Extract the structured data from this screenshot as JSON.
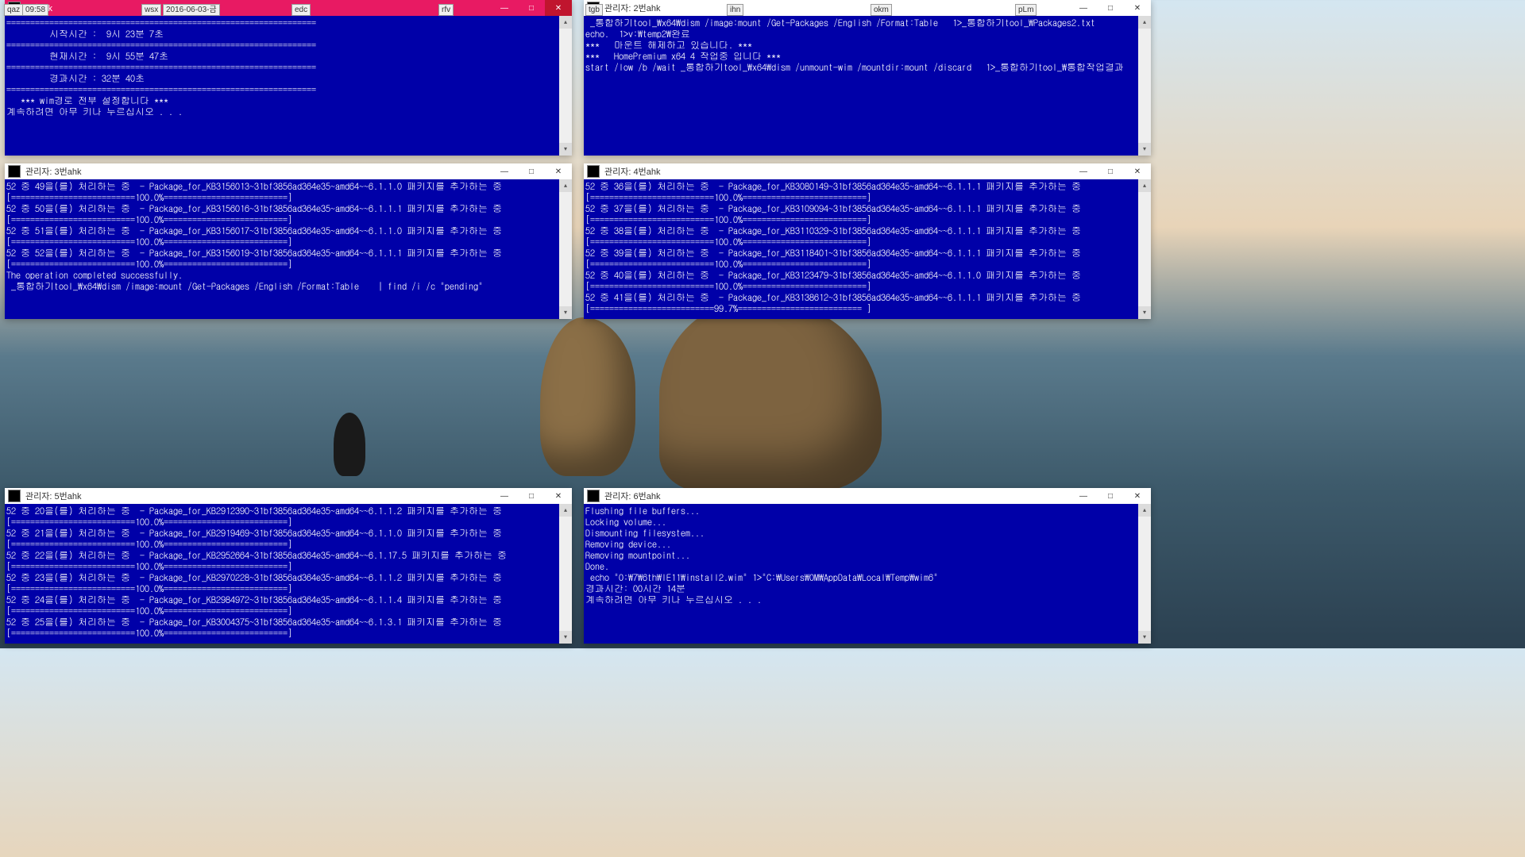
{
  "labels": {
    "qaz": "qaz",
    "time": "09:58",
    "wsx": "wsx",
    "date": "2016-06-03-금",
    "edc": "edc",
    "rfv": "rfv",
    "tgb": "tgb",
    "ihn": "ihn",
    "okm": "okm",
    "plm": "pLm"
  },
  "win1": {
    "title": "1번ahk",
    "lines": [
      "",
      "=================================================================",
      "         시작시간 :  9시 23분 7초",
      "=================================================================",
      "         현재시간 :  9시 55분 47초",
      "=================================================================",
      "         경과시간 : 32분 40초",
      "=================================================================",
      "",
      "   *** wim경로 전부 설정합니다 ***",
      "",
      "계속하려면 아무 키나 누르십시오 . . ."
    ]
  },
  "win2": {
    "title": "관리자: 2번ahk",
    "lines": [
      "",
      " _통합하기tool_\\x64\\dism /image:mount /Get-Packages /English /Format:Table   1>_통합하기tool_\\Packages2.txt",
      "",
      "echo.  1>v:\\temp2\\완료",
      "",
      "***   마운트 해제하고 있습니다. ***",
      "",
      "***   HomePremium x64 4 작업중 입니다 ***",
      "",
      "start /low /b /wait _통합하기tool_\\x64\\dism /unmount-wim /mountdir:mount /discard   1>_통합하기tool_\\통합작업결과"
    ]
  },
  "win3": {
    "title": "관리자: 3번ahk",
    "lines": [
      "52 중 49을(를) 처리하는 중  - Package_for_KB3156013~31bf3856ad364e35~amd64~~6.1.1.0 패키지를 추가하는 중",
      "[==========================100.0%==========================]",
      "52 중 50을(를) 처리하는 중  - Package_for_KB3156016~31bf3856ad364e35~amd64~~6.1.1.1 패키지를 추가하는 중",
      "[==========================100.0%==========================]",
      "52 중 51을(를) 처리하는 중  - Package_for_KB3156017~31bf3856ad364e35~amd64~~6.1.1.0 패키지를 추가하는 중",
      "[==========================100.0%==========================]",
      "52 중 52을(를) 처리하는 중  - Package_for_KB3156019~31bf3856ad364e35~amd64~~6.1.1.1 패키지를 추가하는 중",
      "[==========================100.0%==========================]",
      "The operation completed successfully.",
      "",
      " _통합하기tool_\\x64\\dism /image:mount /Get-Packages /English /Format:Table    | find /i /c \"pending\""
    ]
  },
  "win4": {
    "title": "관리자: 4번ahk",
    "lines": [
      "52 중 36을(를) 처리하는 중  - Package_for_KB3080149~31bf3856ad364e35~amd64~~6.1.1.1 패키지를 추가하는 중",
      "[==========================100.0%==========================]",
      "52 중 37을(를) 처리하는 중  - Package_for_KB3109094~31bf3856ad364e35~amd64~~6.1.1.1 패키지를 추가하는 중",
      "[==========================100.0%==========================]",
      "52 중 38을(를) 처리하는 중  - Package_for_KB3110329~31bf3856ad364e35~amd64~~6.1.1.1 패키지를 추가하는 중",
      "[==========================100.0%==========================]",
      "52 중 39을(를) 처리하는 중  - Package_for_KB3118401~31bf3856ad364e35~amd64~~6.1.1.1 패키지를 추가하는 중",
      "[==========================100.0%==========================]",
      "52 중 40을(를) 처리하는 중  - Package_for_KB3123479~31bf3856ad364e35~amd64~~6.1.1.0 패키지를 추가하는 중",
      "[==========================100.0%==========================]",
      "52 중 41을(를) 처리하는 중  - Package_for_KB3138612~31bf3856ad364e35~amd64~~6.1.1.1 패키지를 추가하는 중",
      "[==========================99.7%========================== ]"
    ]
  },
  "win5": {
    "title": "관리자: 5번ahk",
    "lines": [
      "52 중 20을(를) 처리하는 중  - Package_for_KB2912390~31bf3856ad364e35~amd64~~6.1.1.2 패키지를 추가하는 중",
      "[==========================100.0%==========================]",
      "52 중 21을(를) 처리하는 중  - Package_for_KB2919469~31bf3856ad364e35~amd64~~6.1.1.0 패키지를 추가하는 중",
      "[==========================100.0%==========================]",
      "52 중 22을(를) 처리하는 중  - Package_for_KB2952664~31bf3856ad364e35~amd64~~6.1.17.5 패키지를 추가하는 중",
      "[==========================100.0%==========================]",
      "52 중 23을(를) 처리하는 중  - Package_for_KB2970228~31bf3856ad364e35~amd64~~6.1.1.2 패키지를 추가하는 중",
      "[==========================100.0%==========================]",
      "52 중 24을(를) 처리하는 중  - Package_for_KB2984972~31bf3856ad364e35~amd64~~6.1.1.4 패키지를 추가하는 중",
      "[==========================100.0%==========================]",
      "52 중 25을(를) 처리하는 중  - Package_for_KB3004375~31bf3856ad364e35~amd64~~6.1.3.1 패키지를 추가하는 중",
      "[==========================100.0%==========================]"
    ]
  },
  "win6": {
    "title": "관리자: 6번ahk",
    "lines": [
      "Flushing file buffers...",
      "Locking volume...",
      "Dismounting filesystem...",
      "Removing device...",
      "Removing mountpoint...",
      "Done.",
      "",
      " echo \"O:\\7\\6th\\IE11\\install2.wim\" 1>\"C:\\Users\\OM\\AppData\\Local\\Temp\\wim6\"",
      "",
      "경과시간: 00시간 14분",
      "",
      "계속하려면 아무 키나 누르십시오 . . ."
    ]
  },
  "glyphs": {
    "min": "—",
    "max": "□",
    "close": "✕",
    "up": "▴",
    "down": "▾"
  }
}
